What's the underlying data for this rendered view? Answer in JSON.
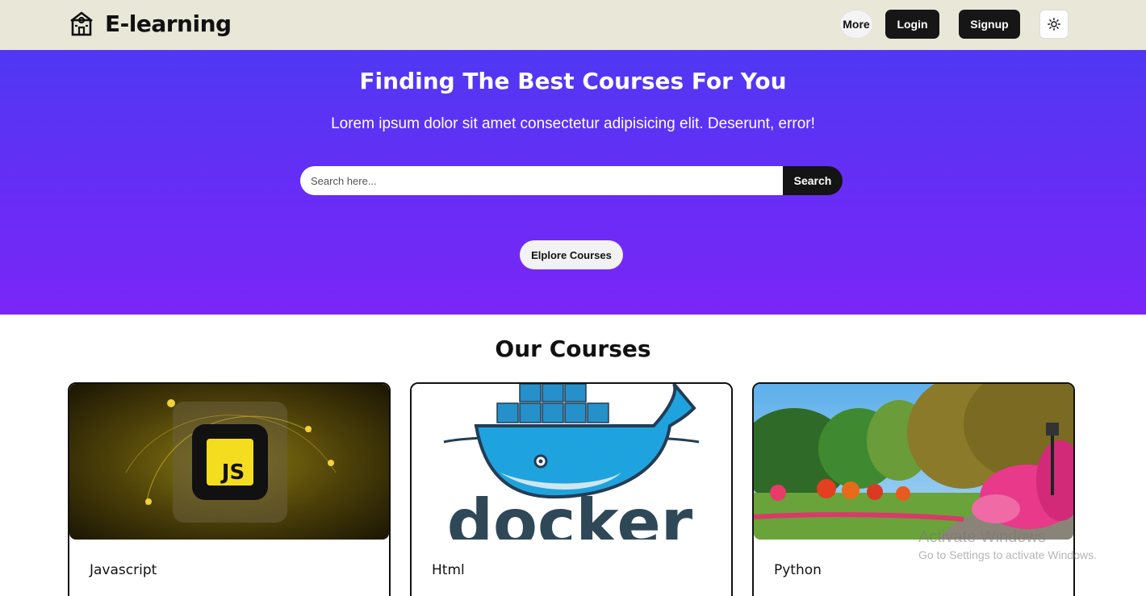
{
  "navbar": {
    "brand_name": "E-learning",
    "brand_icon": "school-icon",
    "more_label": "More",
    "login_label": "Login",
    "signup_label": "Signup",
    "theme_icon": "sun-icon"
  },
  "hero": {
    "title": "Finding The Best Courses For You",
    "subtitle": "Lorem ipsum dolor sit amet consectetur adipisicing elit. Deserunt, error!",
    "search_placeholder": "Search here...",
    "search_label": "Search",
    "explore_label": "Elplore Courses",
    "gradient_top": "#4f38f3",
    "gradient_bottom": "#7a26f7"
  },
  "courses": {
    "title": "Our Courses",
    "items": [
      {
        "title": "Javascript",
        "image": "javascript-logo-image"
      },
      {
        "title": "Html",
        "image": "docker-whale-image"
      },
      {
        "title": "Python",
        "image": "garden-park-image"
      }
    ]
  },
  "watermark": {
    "title": "Activate Windows",
    "subtitle": "Go to Settings to activate Windows."
  }
}
